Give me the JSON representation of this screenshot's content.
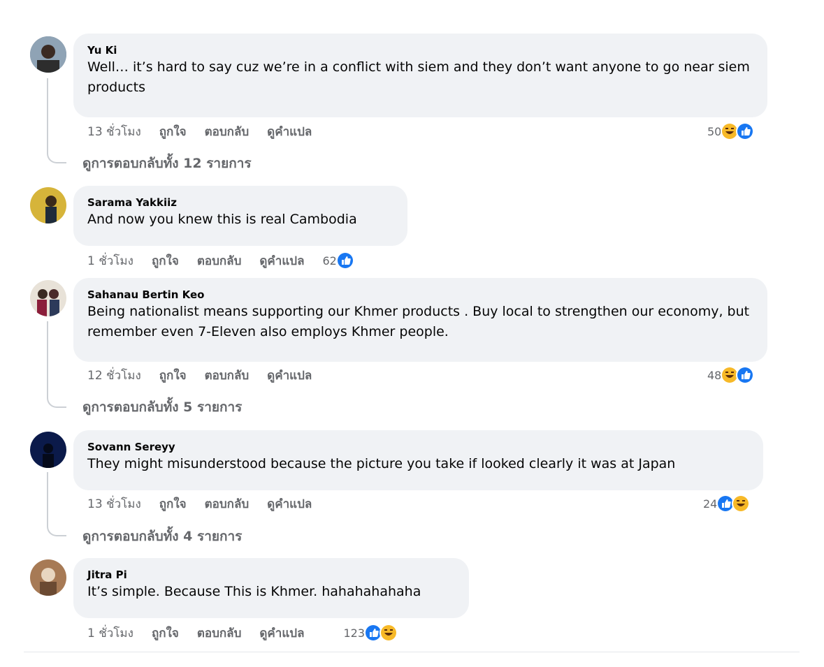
{
  "comments": [
    {
      "author": "Yu Ki",
      "text": "Well… it’s hard to say cuz we’re in a conflict with siem and they don’t want anyone to go near siem products",
      "time": "13 ชั่วโมง",
      "like": "ถูกใจ",
      "reply": "ตอบกลับ",
      "translate": "ดูคำแปล",
      "reaction_count": "50",
      "replies_link": "ดูการตอบกลับทั้ง 12 รายการ"
    },
    {
      "author": "Sarama Yakkiiz",
      "text": "And now you knew this is real Cambodia",
      "time": "1 ชั่วโมง",
      "like": "ถูกใจ",
      "reply": "ตอบกลับ",
      "translate": "ดูคำแปล",
      "reaction_count": "62"
    },
    {
      "author": "Sahanau Bertin Keo",
      "text": "Being nationalist means supporting our Khmer products . Buy local to strengthen our economy, but remember even 7-Eleven also employs Khmer people.",
      "time": "12 ชั่วโมง",
      "like": "ถูกใจ",
      "reply": "ตอบกลับ",
      "translate": "ดูคำแปล",
      "reaction_count": "48",
      "replies_link": "ดูการตอบกลับทั้ง 5 รายการ"
    },
    {
      "author": "Sovann Sereyy",
      "text": "They might misunderstood because the picture you take if looked clearly it was at Japan",
      "time": "13 ชั่วโมง",
      "like": "ถูกใจ",
      "reply": "ตอบกลับ",
      "translate": "ดูคำแปล",
      "reaction_count": "24",
      "replies_link": "ดูการตอบกลับทั้ง 4 รายการ"
    },
    {
      "author": "Jitra Pi",
      "text": "It’s simple. Because This is Khmer. hahahahahaha",
      "time": "1 ชั่วโมง",
      "like": "ถูกใจ",
      "reply": "ตอบกลับ",
      "translate": "ดูคำแปล",
      "reaction_count": "123"
    }
  ],
  "colors": {
    "bubble": "#f0f2f5",
    "secondary_text": "#65676b",
    "like_blue": "#1877f2",
    "haha_yellow": "#f7b928"
  },
  "icons": [
    "like-reaction-icon",
    "haha-reaction-icon"
  ]
}
